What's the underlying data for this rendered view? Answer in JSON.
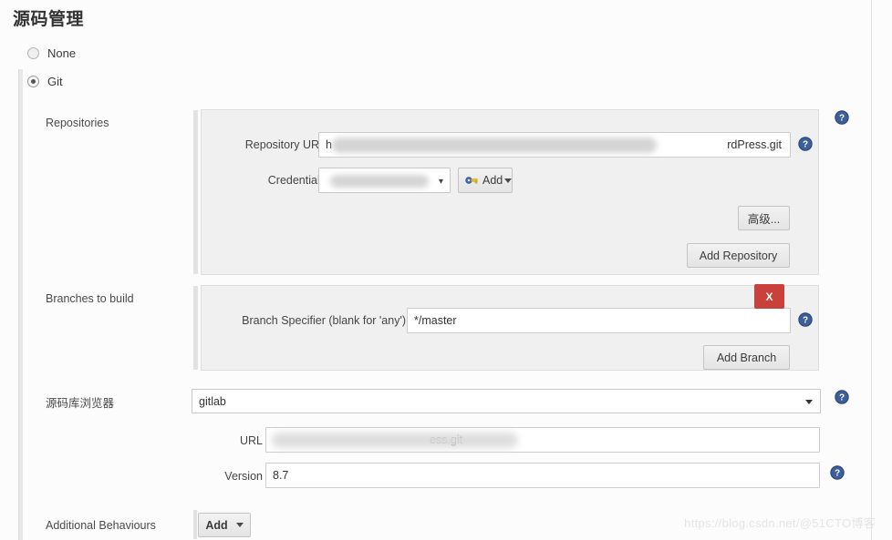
{
  "page": {
    "title": "源码管理",
    "watermark": "https://blog.csdn.net/@51CTO博客"
  },
  "scm_choice": {
    "options": [
      {
        "label": "None",
        "selected": false
      },
      {
        "label": "Git",
        "selected": true
      }
    ]
  },
  "repositories": {
    "label": "Repositories",
    "repository_url": {
      "label": "Repository URL",
      "value_prefix": "h",
      "value_suffix": "rdPress.git",
      "redacted": true
    },
    "credentials": {
      "label": "Credentials",
      "value": "",
      "redacted": true,
      "add_button": "Add",
      "add_icon": "key-icon"
    },
    "advanced_button": "高级...",
    "add_repository_button": "Add Repository"
  },
  "branches": {
    "label": "Branches to build",
    "branch_specifier": {
      "label": "Branch Specifier (blank for 'any')",
      "value": "*/master"
    },
    "delete_button": "X",
    "add_branch_button": "Add Branch"
  },
  "repo_browser": {
    "label": "源码库浏览器",
    "selected": "gitlab",
    "url": {
      "label": "URL",
      "value_suffix": "ess.git",
      "redacted": true
    },
    "version": {
      "label": "Version",
      "value": "8.7"
    }
  },
  "additional_behaviours": {
    "label": "Additional Behaviours",
    "add_button": "Add"
  },
  "icons": {
    "help": "help-icon",
    "caret_down": "chevron-down-icon"
  },
  "colors": {
    "delete_red": "#c9413a",
    "help_blue": "#36568c",
    "panel_bg": "#f0f0f0",
    "page_bg": "#fcfcfc"
  }
}
